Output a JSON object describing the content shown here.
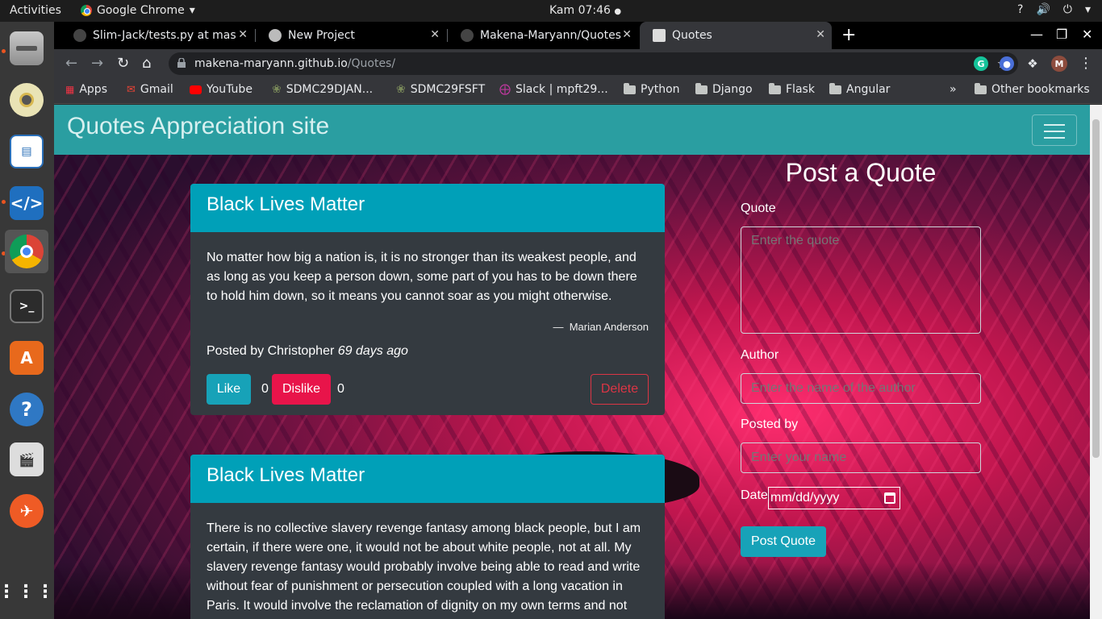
{
  "os": {
    "activities": "Activities",
    "app_name": "Google Chrome",
    "app_caret": "▾",
    "clock": "Kam 07:46",
    "clock_dot": "●"
  },
  "browser": {
    "tabs": [
      {
        "title": "Slim-Jack/tests.py at mast",
        "icon": "github-icon"
      },
      {
        "title": "New Project",
        "icon": "globe-icon"
      },
      {
        "title": "Makena-Maryann/Quotes",
        "icon": "github-icon"
      },
      {
        "title": "Quotes",
        "icon": "angular-icon"
      }
    ],
    "url_host": "makena-maryann.github.io",
    "url_path": "/Quotes/",
    "profile_initial": "M",
    "bookmarks": [
      {
        "label": "Apps",
        "icon": "apps-grid-icon"
      },
      {
        "label": "Gmail",
        "icon": "gmail-icon"
      },
      {
        "label": "YouTube",
        "icon": "youtube-icon"
      },
      {
        "label": "SDMC29DJAN...",
        "icon": "palm-icon"
      },
      {
        "label": "SDMC29FSFT",
        "icon": "palm-icon"
      },
      {
        "label": "Slack | mpft29...",
        "icon": "slack-icon"
      },
      {
        "label": "Python",
        "icon": "folder-icon"
      },
      {
        "label": "Django",
        "icon": "folder-icon"
      },
      {
        "label": "Flask",
        "icon": "folder-icon"
      },
      {
        "label": "Angular",
        "icon": "folder-icon"
      }
    ],
    "bookmarks_overflow": "»",
    "other_bookmarks": "Other bookmarks"
  },
  "site": {
    "brand": "Quotes Appreciation site",
    "quotes": [
      {
        "title": "Black Lives Matter",
        "text": "No matter how big a nation is, it is no stronger than its weakest people, and as long as you keep a person down, some part of you has to be down there to hold him down, so it means you cannot soar as you might otherwise.",
        "author": "Marian Anderson",
        "posted_prefix": "Posted by Christopher",
        "posted_ago": "69 days ago",
        "likes": "0",
        "dislikes": "0"
      },
      {
        "title": "Black Lives Matter",
        "text": "There is no collective slavery revenge fantasy among black people, but I am certain, if there were one, it would not be about white people, not at all. My slavery revenge fantasy would probably involve being able to read and write without fear of punishment or persecution coupled with a long vacation in Paris. It would involve the reclamation of dignity on my own terms and not"
      }
    ],
    "buttons": {
      "like": "Like",
      "dislike": "Dislike",
      "delete": "Delete"
    },
    "cite_dash": "—",
    "form": {
      "heading": "Post a Quote",
      "quote_label": "Quote",
      "quote_placeholder": "Enter the quote",
      "author_label": "Author",
      "author_placeholder": "Enter the name of the author",
      "posted_label": "Posted by",
      "posted_placeholder": "Enter your name",
      "date_label": "Date",
      "date_placeholder": "mm/dd/yyyy",
      "submit": "Post Quote"
    }
  },
  "colors": {
    "navbar": "#2a9ea1",
    "card_header": "#00a0b8",
    "card_body": "#343a40",
    "like": "#17a2b8",
    "dislike": "#e8144a",
    "delete_border": "#dc3545"
  }
}
